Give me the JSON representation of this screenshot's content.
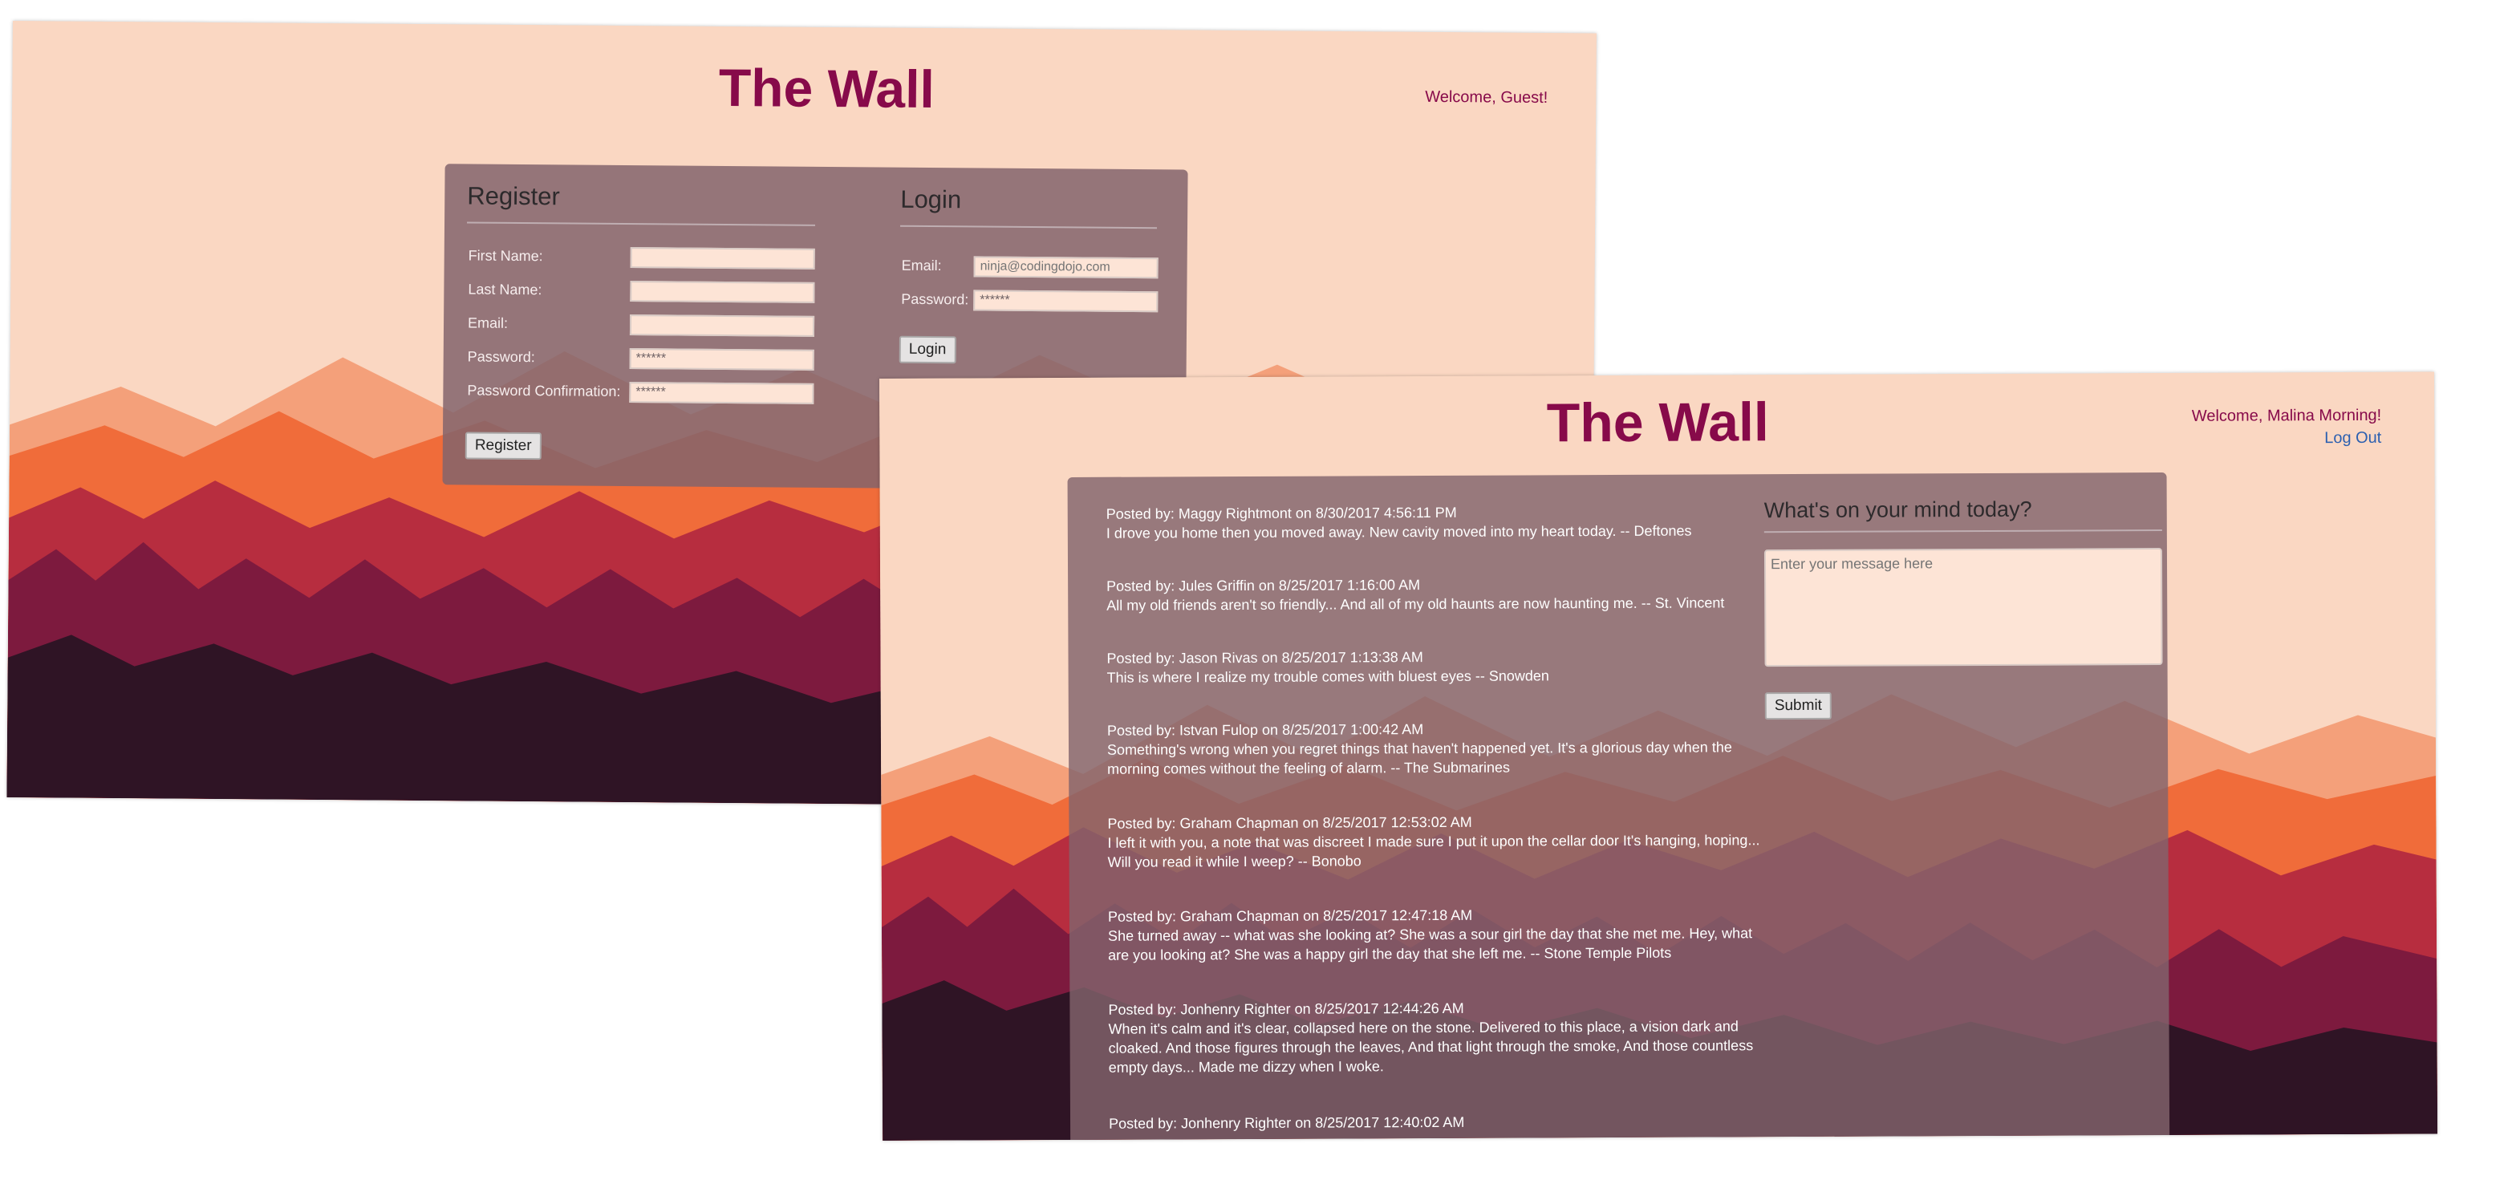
{
  "colors": {
    "background": "#fad7c2",
    "title": "#870a4a",
    "panel": "#826470",
    "link": "#2b5fb0"
  },
  "login_screen": {
    "title": "The Wall",
    "welcome": "Welcome, Guest!",
    "register": {
      "heading": "Register",
      "fields": {
        "first_name": {
          "label": "First Name:",
          "value": ""
        },
        "last_name": {
          "label": "Last Name:",
          "value": ""
        },
        "email": {
          "label": "Email:",
          "value": ""
        },
        "password": {
          "label": "Password:",
          "value": "******"
        },
        "password_confirmation": {
          "label": "Password Confirmation:",
          "value": "******"
        }
      },
      "button": "Register"
    },
    "login": {
      "heading": "Login",
      "email": {
        "label": "Email:",
        "placeholder": "ninja@codingdojo.com"
      },
      "password": {
        "label": "Password:",
        "value": "******"
      },
      "button": "Login"
    }
  },
  "wall_screen": {
    "title": "The Wall",
    "welcome": "Welcome, Malina Morning!",
    "logout": "Log Out",
    "composer": {
      "heading": "What's on your mind today?",
      "placeholder": "Enter your message here",
      "button": "Submit"
    },
    "posts": [
      {
        "meta": "Posted by: Maggy Rightmont on 8/30/2017 4:56:11 PM",
        "text": "I drove you home then you moved away. New cavity moved into my heart today. -- Deftones"
      },
      {
        "meta": "Posted by: Jules Griffin on 8/25/2017 1:16:00 AM",
        "text": "All my old friends aren't so friendly... And all of my old haunts are now haunting me. -- St. Vincent"
      },
      {
        "meta": "Posted by: Jason Rivas on 8/25/2017 1:13:38 AM",
        "text": "This is where I realize my trouble comes with bluest eyes -- Snowden"
      },
      {
        "meta": "Posted by: Istvan Fulop on 8/25/2017 1:00:42 AM",
        "text": "Something's wrong when you regret things that haven't happened yet. It's a glorious day when the morning comes without the feeling of alarm. -- The Submarines"
      },
      {
        "meta": "Posted by: Graham Chapman on 8/25/2017 12:53:02 AM",
        "text": "I left it with you, a note that was discreet I made sure I put it upon the cellar door It's hanging, hoping... Will you read it while I weep? -- Bonobo"
      },
      {
        "meta": "Posted by: Graham Chapman on 8/25/2017 12:47:18 AM",
        "text": "She turned away -- what was she looking at? She was a sour girl the day that she met me. Hey, what are you looking at? She was a happy girl the day that she left me. -- Stone Temple Pilots"
      },
      {
        "meta": "Posted by: Jonhenry Righter on 8/25/2017 12:44:26 AM",
        "text": "When it's calm and it's clear, collapsed here on the stone. Delivered to this place, a vision dark and cloaked. And those figures through the leaves, And that light through the smoke, And those countless empty days... Made me dizzy when I woke."
      },
      {
        "meta": "Posted by: Jonhenry Righter on 8/25/2017 12:40:02 AM",
        "text": ""
      }
    ]
  }
}
